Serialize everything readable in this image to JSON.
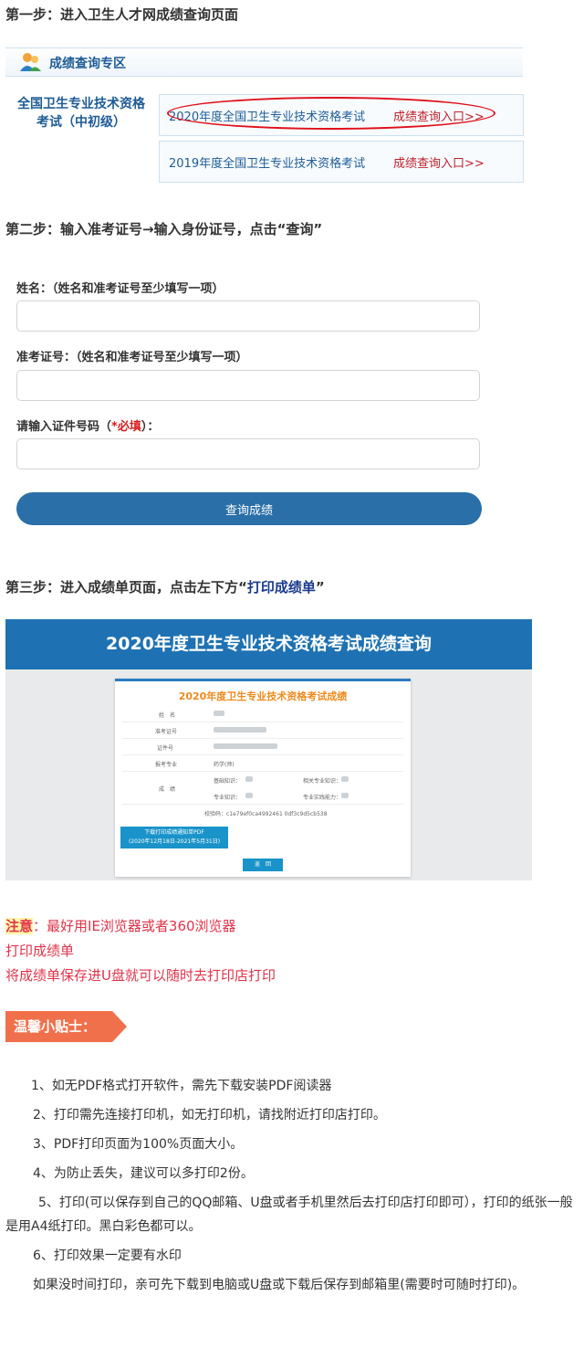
{
  "step1": {
    "title": "第一步：进入卫生人才网成绩查询页面",
    "zone_title": "成绩查询专区",
    "category_line1": "全国卫生专业技术资格",
    "category_line2": "考试（中初级）",
    "entries": [
      {
        "name": "2020年度全国卫生专业技术资格考试",
        "link": "成绩查询入口>>"
      },
      {
        "name": "2019年度全国卫生专业技术资格考试",
        "link": "成绩查询入口>>"
      }
    ]
  },
  "step2": {
    "title": "第二步：输入准考证号→输入身份证号，点击“查询”",
    "name_label": "姓名：（姓名和准考证号至少填写一项）",
    "ticket_label": "准考证号：（姓名和准考证号至少填写一项）",
    "id_label_prefix": "请输入证件号码（",
    "id_label_required": "*必填",
    "id_label_suffix": "）：",
    "button": "查询成绩"
  },
  "step3": {
    "title_prefix": "第三步：进入成绩单页面，点击左下方“",
    "title_highlight": "打印成绩单",
    "title_suffix": "”",
    "shot": {
      "banner": "2020年度卫生专业技术资格考试成绩查询",
      "card_title": "2020年度卫生专业技术资格考试成绩",
      "row_name": "姓　名",
      "row_ticket": "准考证号",
      "row_id": "证件号",
      "row_major": "报考专业",
      "row_major_value": "药学(师)",
      "row_score": "成　绩",
      "score_basic": "基础知识：",
      "score_related": "相关专业知识：",
      "score_prof": "专业知识：",
      "score_practice": "专业实践能力：",
      "verify": "校验码：c1e79ef0ca4992461 0df3c9d5cb538",
      "download_line1": "下载打印成绩通知单PDF",
      "download_line2": "(2020年12月18日-2021年5月31日)",
      "back": "返　回"
    }
  },
  "notes": {
    "label": "注意",
    "line1": "：最好用IE浏览器或者360浏览器",
    "line2": "打印成绩单",
    "line3": "将成绩单保存进U盘就可以随时去打印店打印"
  },
  "tips": {
    "banner": "温馨小贴士：",
    "items": [
      "1、如无PDF格式打开软件，需先下载安装PDF阅读器",
      "2、打印需先连接打印机，如无打印机，请找附近打印店打印。",
      "3、PDF打印页面为100%页面大小。",
      "4、为防止丢失，建议可以多打印2份。",
      "5、打印(可以保存到自己的QQ邮箱、U盘或者手机里然后去打印店打印即可），打印的纸张一般是用A4纸打印。黑白彩色都可以。",
      "6、打印效果一定要有水印",
      "如果没时间打印，亲可先下载到电脑或U盘或下载后保存到邮箱里(需要时可随时打印)。"
    ]
  }
}
